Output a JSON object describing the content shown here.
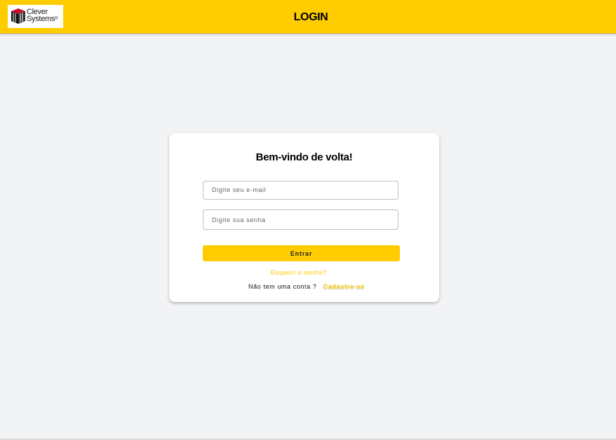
{
  "header": {
    "title": "LOGIN",
    "logo": {
      "line1": "Clever",
      "line2": "Systems",
      "mark": "®"
    }
  },
  "card": {
    "heading": "Bem-vindo de volta!",
    "email_placeholder": "Digite seu e-mail",
    "password_placeholder": "Digite sua senha",
    "enter_label": "Entrar",
    "forgot_label": "Esqueci a senha?",
    "no_account_text": "Não tem uma conta ?",
    "signup_label": "Cadastre-se"
  },
  "colors": {
    "accent": "#ffcc00",
    "background": "#f2f3f5",
    "card": "#ffffff",
    "logo_red": "#c8102e"
  }
}
